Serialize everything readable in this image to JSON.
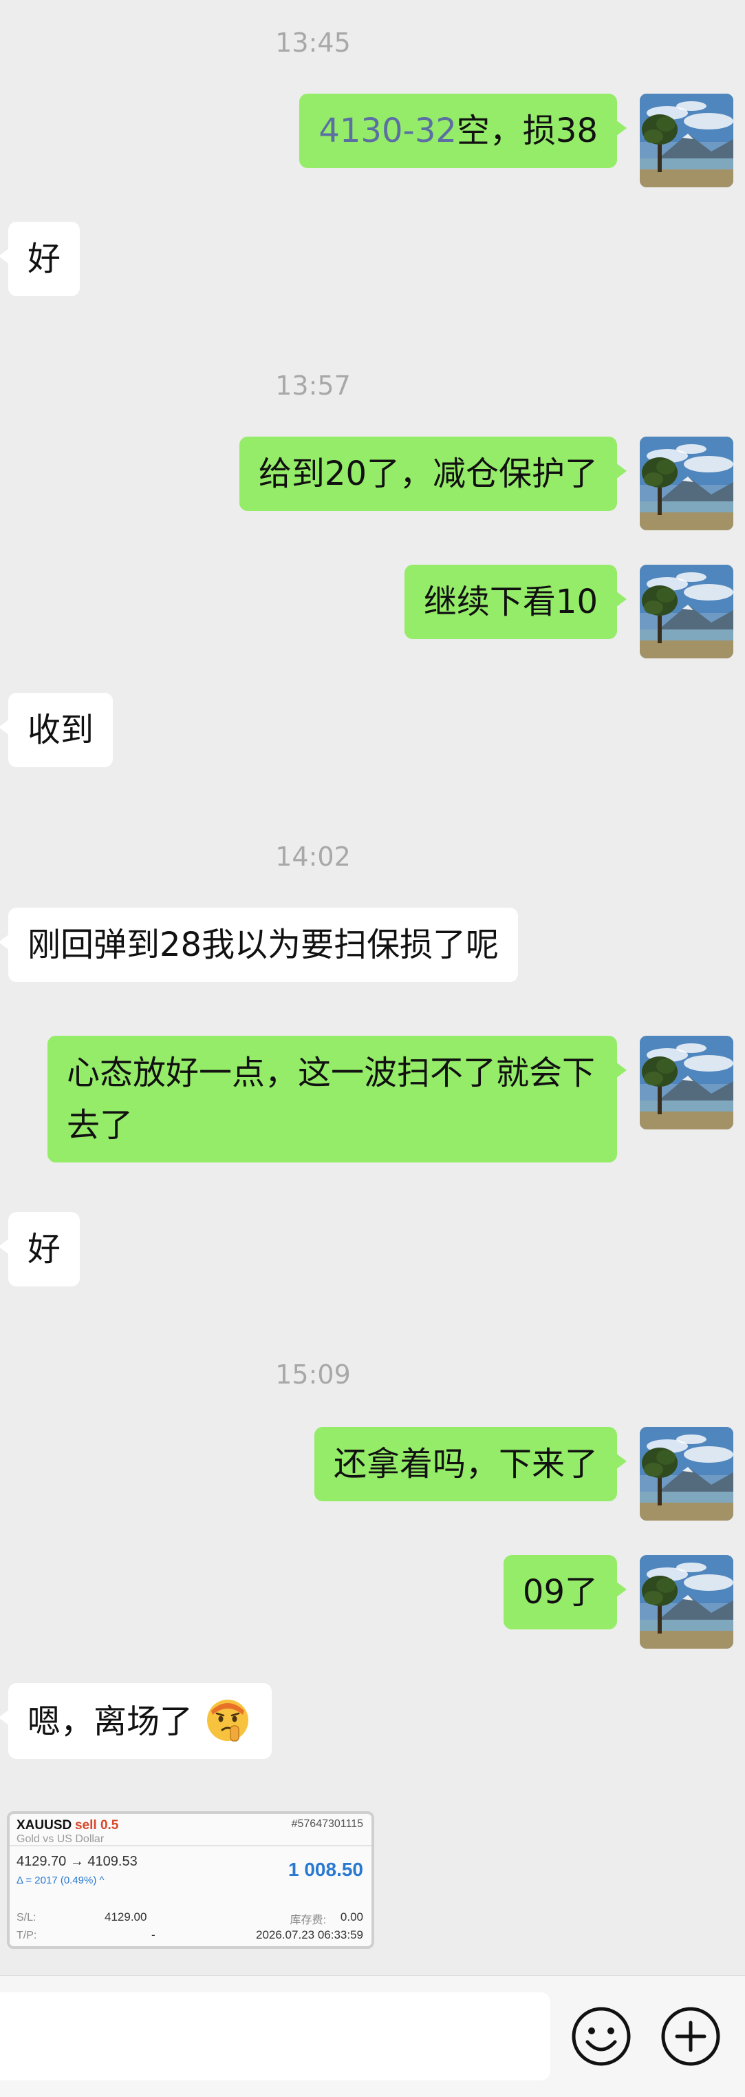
{
  "timestamps": [
    "13:45",
    "13:57",
    "14:02",
    "15:09"
  ],
  "messages": {
    "m1_prefix": "4130-32",
    "m1_suffix": "空，损38",
    "m2": "好",
    "m3": "给到20了，减仓保护了",
    "m4": "继续下看10",
    "m5": "收到",
    "m6": "刚回弹到28我以为要扫保损了呢",
    "m7": "心态放好一点，这一波扫不了就会下去了",
    "m8": "好",
    "m9": "还拿着吗，下来了",
    "m10": "09了",
    "m11": "嗯，离场了"
  },
  "trade_card": {
    "symbol": "XAUUSD",
    "side": "sell 0.5",
    "ticket": "#57647301115",
    "description": "Gold vs US Dollar",
    "prices": "4129.70 → 4109.53",
    "profit": "1 008.50",
    "delta": "Δ = 2017 (0.49%) ^",
    "sl_label": "S/L:",
    "sl_value": "4129.00",
    "swap_label": "库存费:",
    "swap_value": "0.00",
    "tp_label": "T/P:",
    "tp_value": "-",
    "datetime": "2026.07.23 06:33:59"
  },
  "input_bar": {
    "placeholder": "",
    "emoji_button_icon": "smiley-icon",
    "more_button_icon": "plus-circle-icon"
  },
  "colors": {
    "background": "#ededed",
    "outgoing_bubble": "#95ec69",
    "incoming_bubble": "#ffffff",
    "highlight_text": "#5b6fa3",
    "profit": "#2a79d1",
    "sell": "#d9472b"
  }
}
